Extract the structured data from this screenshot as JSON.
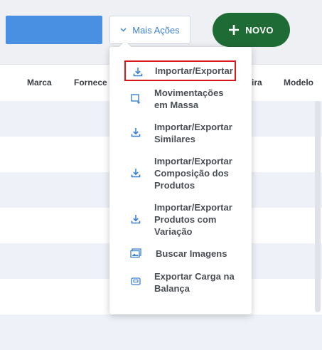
{
  "toolbar": {
    "mais_acoes_label": "Mais Ações",
    "novo_label": "NOVO"
  },
  "table": {
    "columns": [
      "Marca",
      "Fornece",
      "ira",
      "Modelo"
    ]
  },
  "menu": {
    "items": [
      {
        "label": "Importar/Exportar",
        "icon": "download-icon",
        "selected": true
      },
      {
        "label": "Movimentações em Massa",
        "icon": "bulk-move-icon"
      },
      {
        "label": "Importar/Exportar Similares",
        "icon": "download-icon"
      },
      {
        "label": "Importar/Exportar Composição dos Produtos",
        "icon": "download-icon"
      },
      {
        "label": "Importar/Exportar Produtos com Variação",
        "icon": "download-icon"
      },
      {
        "label": "Buscar Imagens",
        "icon": "images-icon"
      },
      {
        "label": "Exportar Carga na Balança",
        "icon": "scale-icon"
      }
    ]
  },
  "colors": {
    "accent_blue": "#3b7fd3",
    "novo_green": "#1f6b35",
    "highlight_red": "#d9181e",
    "row_alt": "#eef2f8"
  }
}
